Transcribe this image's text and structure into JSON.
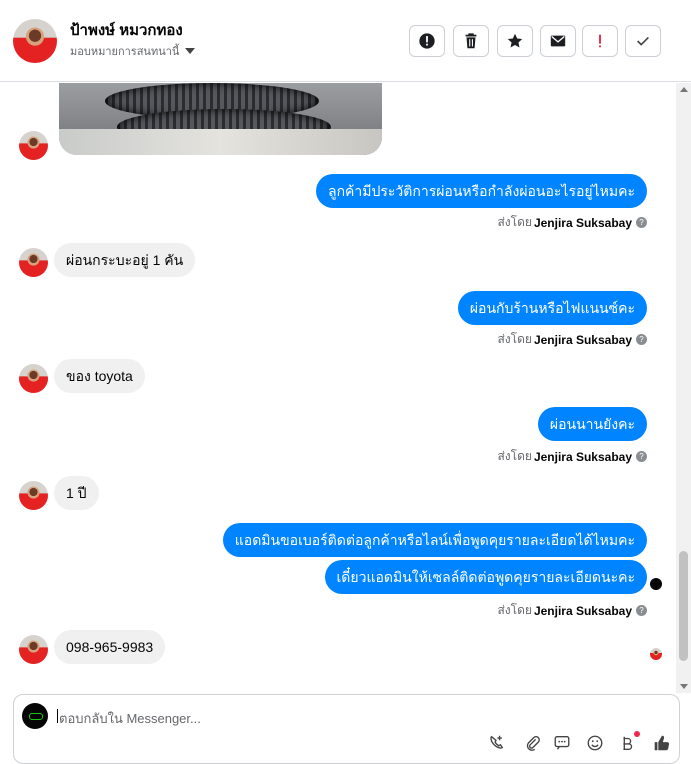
{
  "contact": {
    "name": "ป้าพงษ์ หมวกทอง",
    "assign_label": "มอบหมายการสนทนานี้"
  },
  "toolbar": [
    {
      "name": "report-button",
      "icon": "alert-circle-icon"
    },
    {
      "name": "delete-button",
      "icon": "trash-icon"
    },
    {
      "name": "star-button",
      "icon": "star-icon"
    },
    {
      "name": "email-button",
      "icon": "envelope-icon"
    },
    {
      "name": "important-button",
      "icon": "exclamation-icon"
    },
    {
      "name": "done-button",
      "icon": "check-icon"
    }
  ],
  "messages": [
    {
      "type": "image",
      "from": "customer",
      "description": "tire photo"
    },
    {
      "type": "outgoing",
      "text": "ลูกค้ามีประวัติการผ่อนหรือกำลังผ่อนอะไรอยู่ไหมคะ",
      "sent_prefix": "ส่งโดย",
      "sender": "Jenjira Suksabay"
    },
    {
      "type": "incoming",
      "text": "ผ่อนกระบะอยู่ 1 คัน"
    },
    {
      "type": "outgoing",
      "text": "ผ่อนกับร้านหรือไฟแนนซ์คะ",
      "sent_prefix": "ส่งโดย",
      "sender": "Jenjira Suksabay"
    },
    {
      "type": "incoming",
      "text": "ของ toyota"
    },
    {
      "type": "outgoing",
      "text": "ผ่อนนานยังคะ",
      "sent_prefix": "ส่งโดย",
      "sender": "Jenjira Suksabay"
    },
    {
      "type": "incoming",
      "text": "1 ปี"
    },
    {
      "type": "outgoing",
      "text": "แอดมินขอเบอร์ติดต่อลูกค้าหรือไลน์เพื่อพูดคุยรายละเอียดได้ไหมคะ"
    },
    {
      "type": "outgoing",
      "text": "เดี๋ยวแอดมินให้เซลล์ติดต่อพูดคุยรายละเอียดนะคะ",
      "sent_prefix": "ส่งโดย",
      "sender": "Jenjira Suksabay"
    },
    {
      "type": "incoming",
      "text": "098-965-9983"
    }
  ],
  "composer": {
    "placeholder": "ตอบกลับใน Messenger..."
  },
  "composer_tools": [
    "add-call-icon",
    "attachment-icon",
    "saved-reply-icon",
    "emoji-icon",
    "baht-icon",
    "thumbs-up-icon"
  ],
  "colors": {
    "accent": "#0084ff",
    "incoming_bubble": "#f0f0f0",
    "notification": "#f02849"
  }
}
